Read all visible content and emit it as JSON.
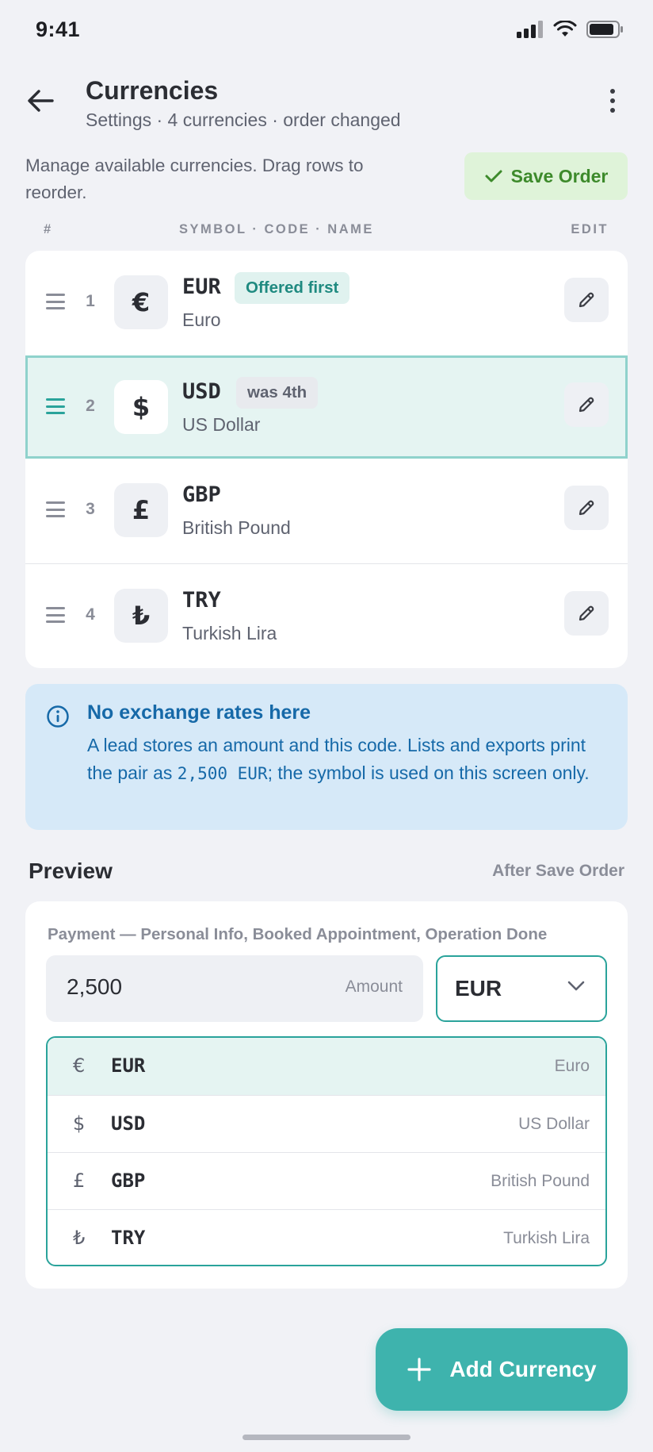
{
  "status_bar": {
    "time": "9:41"
  },
  "header": {
    "title": "Currencies",
    "subtitle": "Settings · 4 currencies · order changed"
  },
  "manage": {
    "text": "Manage available currencies. Drag rows to reorder.",
    "save_label": "Save Order"
  },
  "columns": {
    "num": "#",
    "main": "SYMBOL · CODE · NAME",
    "edit": "EDIT"
  },
  "currencies": [
    {
      "num": "1",
      "symbol": "€",
      "code": "EUR",
      "name": "Euro",
      "badge": "Offered first"
    },
    {
      "num": "2",
      "symbol": "$",
      "code": "USD",
      "name": "US Dollar",
      "badge": "was 4th"
    },
    {
      "num": "3",
      "symbol": "£",
      "code": "GBP",
      "name": "British Pound"
    },
    {
      "num": "4",
      "symbol": "₺",
      "code": "TRY",
      "name": "Turkish Lira"
    }
  ],
  "info": {
    "title": "No exchange rates here",
    "body_pre": "A lead stores an amount and this code. Lists and exports print the pair as ",
    "body_code": "2,500 EUR",
    "body_post": "; the symbol is used on this screen only."
  },
  "preview": {
    "title": "Preview",
    "note": "After Save Order",
    "payment_label": "Payment — Personal Info, Booked Appointment, Operation Done",
    "amount_value": "2,500",
    "amount_label": "Amount",
    "selected_currency": "EUR",
    "options": [
      {
        "symbol": "€",
        "code": "EUR",
        "name": "Euro"
      },
      {
        "symbol": "$",
        "code": "USD",
        "name": "US Dollar"
      },
      {
        "symbol": "£",
        "code": "GBP",
        "name": "British Pound"
      },
      {
        "symbol": "₺",
        "code": "TRY",
        "name": "Turkish Lira"
      }
    ]
  },
  "fab": {
    "label": "Add Currency"
  },
  "colors": {
    "accent": "#3eb3ad",
    "save_bg": "#dff3d9",
    "save_fg": "#3d8a2b",
    "info_bg": "#d6e9f8",
    "info_fg": "#1669a8"
  }
}
